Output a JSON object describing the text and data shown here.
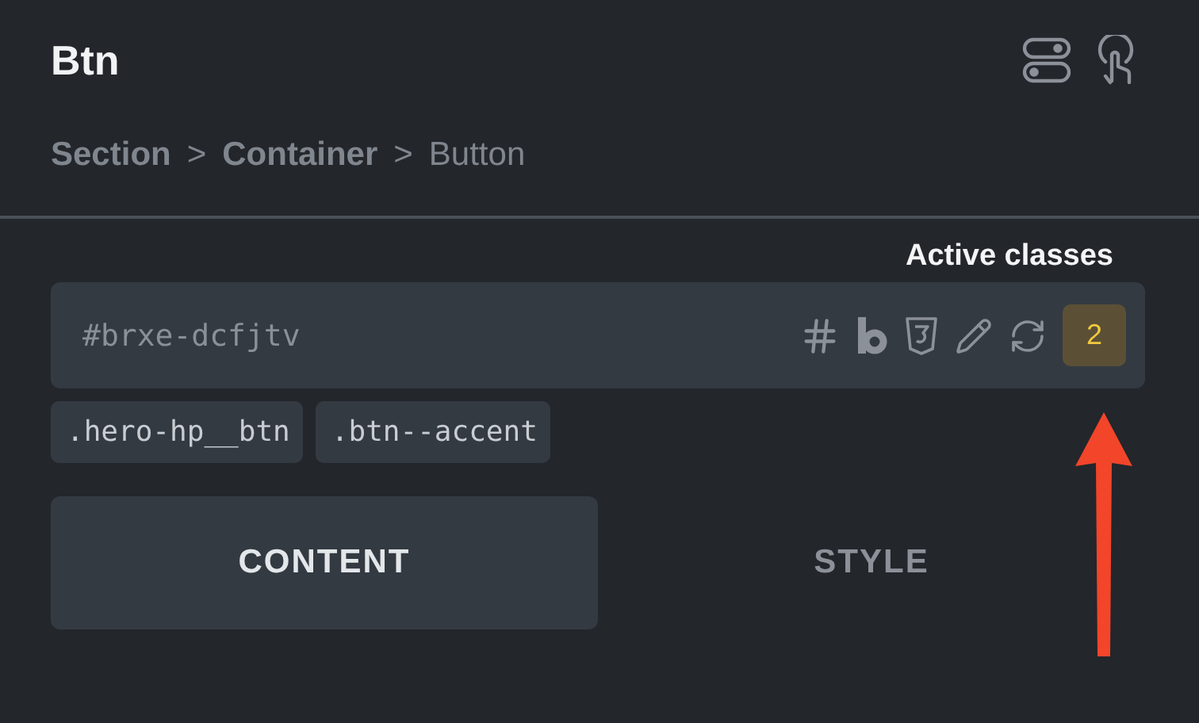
{
  "panel": {
    "title": "Btn"
  },
  "breadcrumb": [
    {
      "label": "Section",
      "current": false
    },
    {
      "separator": ">"
    },
    {
      "label": "Container",
      "current": false
    },
    {
      "separator": ">"
    },
    {
      "label": "Button",
      "current": true
    }
  ],
  "tooltip": {
    "text": "Active classes"
  },
  "id_field": {
    "placeholder": "#brxe-dcfjtv",
    "active_class_count": "2"
  },
  "classes": [
    ".hero-hp__btn",
    ".btn--accent"
  ],
  "tabs": [
    {
      "label": "CONTENT",
      "selected": true
    },
    {
      "label": "STYLE",
      "selected": false
    }
  ]
}
